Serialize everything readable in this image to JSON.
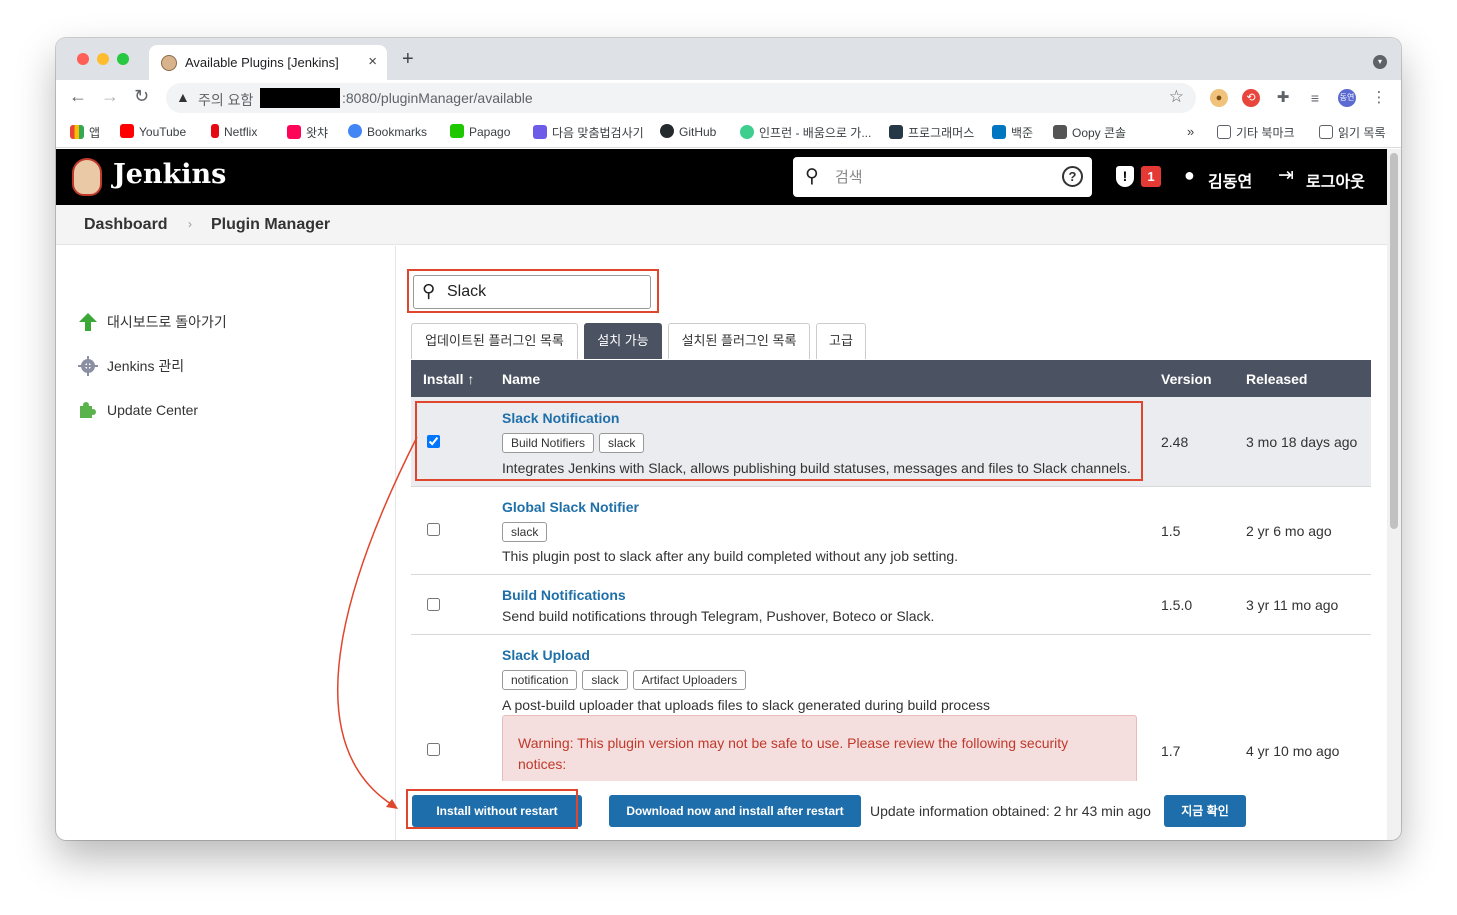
{
  "browser": {
    "tab_title": "Available Plugins [Jenkins]",
    "tab_close": "×",
    "new_tab": "+",
    "url_warning": "주의 요함",
    "url_rest": ":8080/pluginManager/available",
    "bookmarks": [
      {
        "label": "앱",
        "color": "#ea4335"
      },
      {
        "label": "YouTube",
        "color": "#ff0000"
      },
      {
        "label": "Netflix",
        "color": "#e50914"
      },
      {
        "label": "왓챠",
        "color": "#ff0558"
      },
      {
        "label": "Bookmarks",
        "color": "#4285f4"
      },
      {
        "label": "Papago",
        "color": "#1ec800"
      },
      {
        "label": "다음 맞춤법검사기",
        "color": "#6c5ce7"
      },
      {
        "label": "GitHub",
        "color": "#24292e"
      },
      {
        "label": "인프런 - 배움으로 가...",
        "color": "#3ecf8e"
      },
      {
        "label": "프로그래머스",
        "color": "#263747"
      },
      {
        "label": "백준",
        "color": "#0076c0"
      },
      {
        "label": "Oopy 콘솔",
        "color": "#555555"
      }
    ],
    "bookmarks_more": "»",
    "bookmarks_other": "기타 북마크",
    "reading_list": "읽기 목록",
    "profile_initials": "동연"
  },
  "header": {
    "title": "Jenkins",
    "search_placeholder": "검색",
    "help_label": "?",
    "security_count": "1",
    "user_name": "김동연",
    "logout_label": "로그아웃"
  },
  "breadcrumb": {
    "items": [
      "Dashboard",
      "Plugin Manager"
    ]
  },
  "sidebar": {
    "items": [
      {
        "label": "대시보드로 돌아가기"
      },
      {
        "label": "Jenkins 관리"
      },
      {
        "label": "Update Center"
      }
    ]
  },
  "filter": {
    "value": "Slack"
  },
  "tabs": [
    {
      "label": "업데이트된 플러그인 목록"
    },
    {
      "label": "설치 가능"
    },
    {
      "label": "설치된 플러그인 목록"
    },
    {
      "label": "고급"
    }
  ],
  "table": {
    "headers": {
      "install": "Install ↑",
      "name": "Name",
      "version": "Version",
      "released": "Released"
    },
    "rows": [
      {
        "name": "Slack Notification",
        "labels": [
          "Build Notifiers",
          "slack"
        ],
        "description": "Integrates Jenkins with Slack, allows publishing build statuses, messages and files to Slack channels.",
        "version": "2.48",
        "released": "3 mo 18 days ago",
        "checked": true
      },
      {
        "name": "Global Slack Notifier",
        "labels": [
          "slack"
        ],
        "description": "This plugin post to slack after any build completed without any job setting.",
        "version": "1.5",
        "released": "2 yr 6 mo ago",
        "checked": false
      },
      {
        "name": "Build Notifications",
        "labels": [],
        "description": "Send build notifications through Telegram, Pushover, Boteco or Slack.",
        "version": "1.5.0",
        "released": "3 yr 11 mo ago",
        "checked": false
      },
      {
        "name": "Slack Upload",
        "labels": [
          "notification",
          "slack",
          "Artifact Uploaders"
        ],
        "description": "A post-build uploader that uploads files to slack generated during build process",
        "warning": "Warning: This plugin version may not be safe to use. Please review the following security notices:",
        "version": "1.7",
        "released": "4 yr 10 mo ago",
        "checked": false
      }
    ]
  },
  "actions": {
    "install_without_restart": "Install without restart",
    "download_after_restart": "Download now and install after restart",
    "update_info": "Update information obtained: 2 hr 43 min ago",
    "check_now": "지금 확인"
  },
  "colors": {
    "jenkins_header": "#000000",
    "table_header": "#4b5261",
    "link_blue": "#1f6fa8",
    "button_blue": "#1e6eab",
    "highlight_red": "#e0462c"
  }
}
